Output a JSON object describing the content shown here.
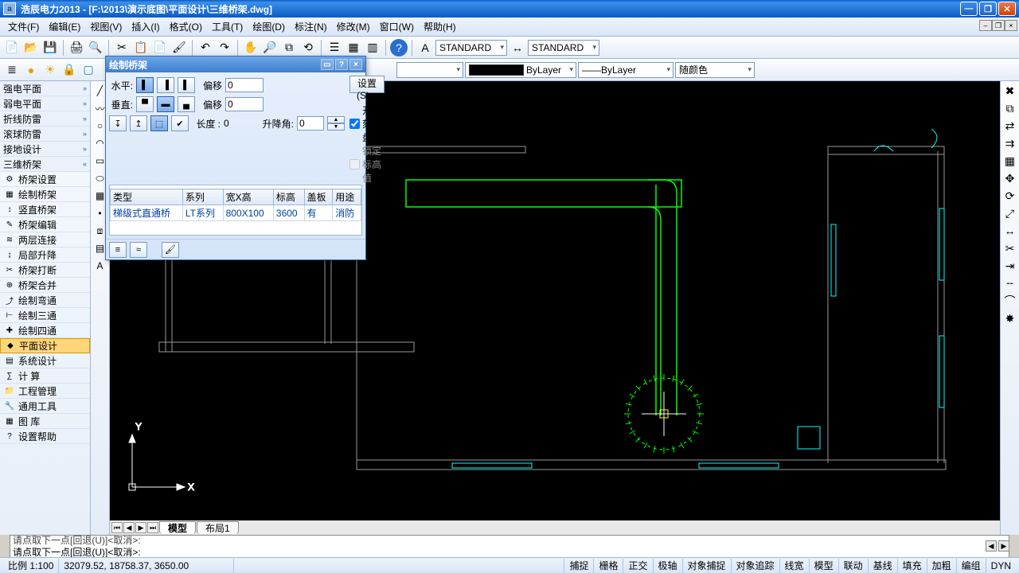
{
  "title": "浩辰电力2013 - [F:\\2013\\演示底图\\平面设计\\三维桥架.dwg]",
  "menu": [
    "文件(F)",
    "编辑(E)",
    "视图(V)",
    "插入(I)",
    "格式(O)",
    "工具(T)",
    "绘图(D)",
    "标注(N)",
    "修改(M)",
    "窗口(W)",
    "帮助(H)"
  ],
  "style_combo1": "STANDARD",
  "style_combo2": "STANDARD",
  "layer_combo": "",
  "linetype": "ByLayer",
  "lineweight": "ByLayer",
  "color_combo": "随颜色",
  "side_categories": [
    {
      "label": "强电平面",
      "open": false
    },
    {
      "label": "弱电平面",
      "open": false
    },
    {
      "label": "折线防雷",
      "open": false
    },
    {
      "label": "滚球防雷",
      "open": false
    },
    {
      "label": "接地设计",
      "open": false
    },
    {
      "label": "三维桥架",
      "open": true,
      "children": [
        {
          "label": "桥架设置",
          "icon": "⚙"
        },
        {
          "label": "绘制桥架",
          "icon": "▦"
        },
        {
          "label": "竖直桥架",
          "icon": "↕"
        },
        {
          "label": "桥架编辑",
          "icon": "✎"
        },
        {
          "label": "两层连接",
          "icon": "≋"
        },
        {
          "label": "局部升降",
          "icon": "↨"
        },
        {
          "label": "桥架打断",
          "icon": "✂"
        },
        {
          "label": "桥架合并",
          "icon": "⊕"
        },
        {
          "label": "绘制弯通",
          "icon": "⤴"
        },
        {
          "label": "绘制三通",
          "icon": "⊢"
        },
        {
          "label": "绘制四通",
          "icon": "✚"
        }
      ]
    }
  ],
  "side_below": [
    {
      "label": "平面设计",
      "icon": "◆",
      "sel": true
    },
    {
      "label": "系统设计",
      "icon": "▤"
    },
    {
      "label": "计    算",
      "icon": "∑"
    },
    {
      "label": "工程管理",
      "icon": "📁"
    },
    {
      "label": "通用工具",
      "icon": "🔧"
    },
    {
      "label": "图    库",
      "icon": "▦"
    },
    {
      "label": "设置帮助",
      "icon": "?"
    }
  ],
  "dialog": {
    "title": "绘制桥架",
    "h_label": "水平:",
    "v_label": "垂直:",
    "offset_label": "偏移",
    "offset_h": "0",
    "offset_v": "0",
    "settings_btn": "设置(S)...",
    "chk_scale": "开启刻度盘",
    "chk_lock": "锁定标高值",
    "length_label": "长度 :",
    "length_val": "0",
    "angle_label": "升降角:",
    "angle_val": "0",
    "cols": [
      "类型",
      "系列",
      "宽X高",
      "标高",
      "盖板",
      "用途"
    ],
    "row": [
      "梯级式直通桥",
      "LT系列",
      "800X100",
      "3600",
      "有",
      "消防"
    ]
  },
  "tabs": {
    "model": "模型",
    "layout1": "布局1"
  },
  "cmd_prev": "请点取下一点[回退(U)]<取消>:",
  "cmd_cur": "请点取下一点[回退(U)]<取消>:",
  "status": {
    "scale_label": "比例 1:100",
    "coords": "32079.52, 18758.37, 3650.00",
    "toggles": [
      "捕捉",
      "栅格",
      "正交",
      "极轴",
      "对象捕捉",
      "对象追踪",
      "线宽",
      "模型",
      "联动",
      "基线",
      "填充",
      "加粗",
      "编组",
      "DYN"
    ]
  },
  "axis": {
    "x": "X",
    "y": "Y"
  }
}
